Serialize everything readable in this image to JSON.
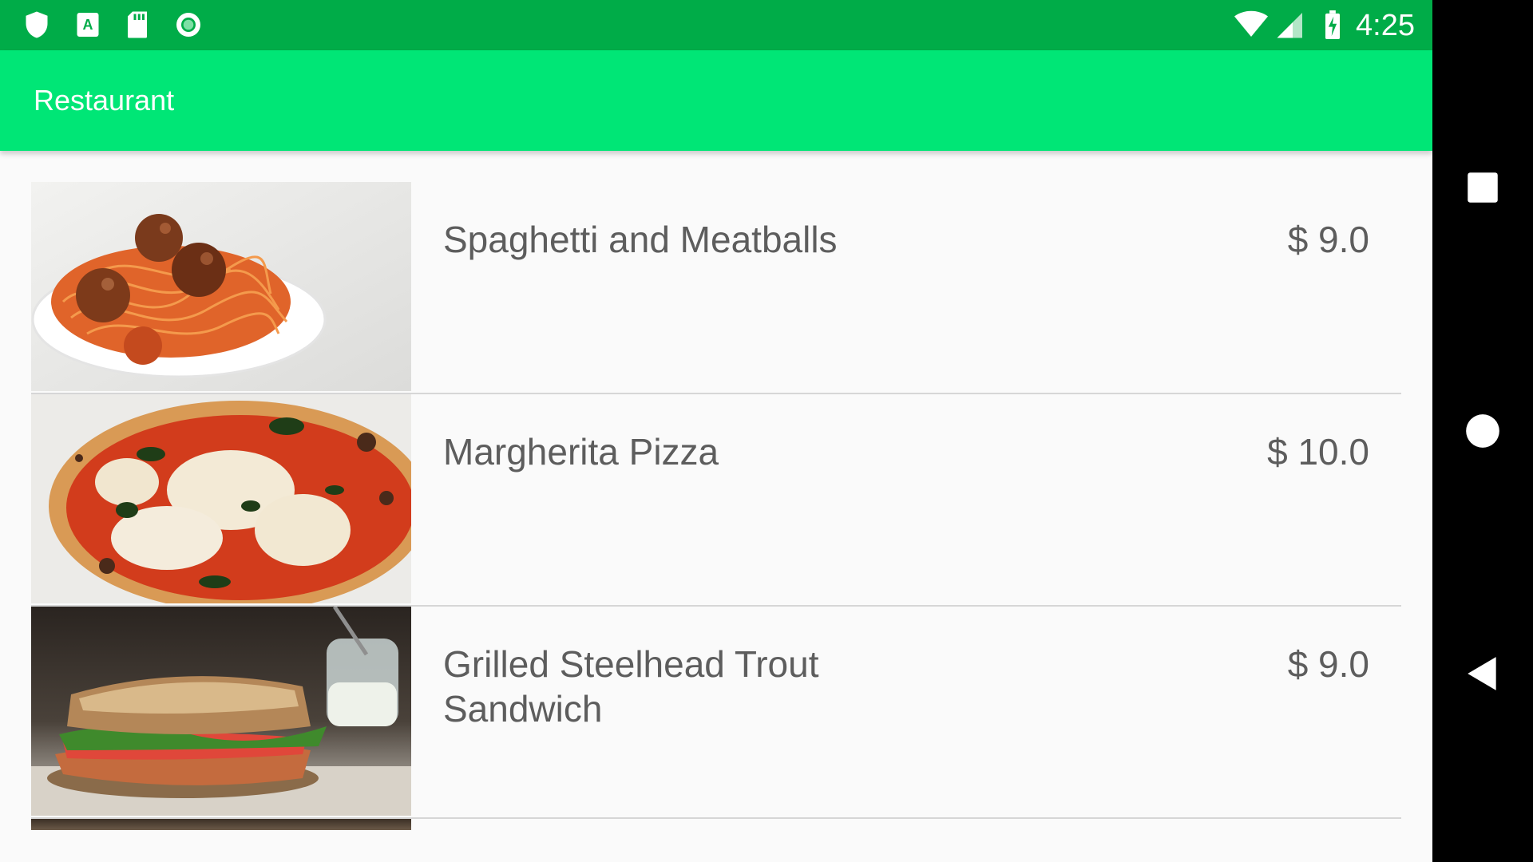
{
  "status_bar": {
    "time": "4:25",
    "left_icons": [
      "shield-icon",
      "text-a-icon",
      "sd-card-icon",
      "record-circle-icon"
    ],
    "right_icons": [
      "wifi-icon",
      "cell-signal-icon",
      "battery-charging-icon"
    ]
  },
  "app_bar": {
    "title": "Restaurant",
    "color": "#00e676"
  },
  "menu": {
    "items": [
      {
        "name": "Spaghetti and Meatballs",
        "price": "$ 9.0",
        "image": "spaghetti-photo"
      },
      {
        "name": "Margherita Pizza",
        "price": "$ 10.0",
        "image": "pizza-photo"
      },
      {
        "name": "Grilled Steelhead Trout Sandwich",
        "price": "$ 9.0",
        "image": "sandwich-photo"
      }
    ]
  },
  "nav_bar": {
    "buttons": [
      "recents-square-icon",
      "home-circle-icon",
      "back-triangle-icon"
    ]
  },
  "colors": {
    "status_bar": "#00ac48",
    "app_bar": "#00e676",
    "background": "#fafafa",
    "text": "#5d5d5d"
  }
}
